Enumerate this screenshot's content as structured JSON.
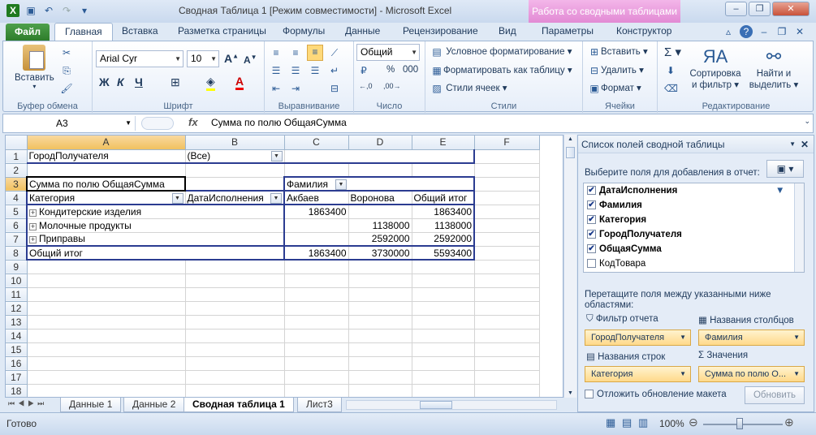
{
  "window": {
    "title": "Сводная Таблица 1  [Режим совместимости]  -  Microsoft Excel",
    "context_tab": "Работа со сводными таблицами"
  },
  "tabs": {
    "file": "Файл",
    "items": [
      "Главная",
      "Вставка",
      "Разметка страницы",
      "Формулы",
      "Данные",
      "Рецензирование",
      "Вид",
      "Параметры",
      "Конструктор"
    ]
  },
  "ribbon": {
    "clipboard": {
      "label": "Буфер обмена",
      "paste": "Вставить"
    },
    "font": {
      "label": "Шрифт",
      "name": "Arial Cyr",
      "size": "10"
    },
    "alignment": {
      "label": "Выравнивание"
    },
    "number": {
      "label": "Число",
      "format": "Общий",
      "percent": "%",
      "thousands": "000"
    },
    "styles": {
      "label": "Стили",
      "conditional": "Условное форматирование",
      "format_table": "Форматировать как таблицу",
      "cell_styles": "Стили ячеек"
    },
    "cells": {
      "label": "Ячейки",
      "insert": "Вставить",
      "delete": "Удалить",
      "format": "Формат"
    },
    "editing": {
      "label": "Редактирование",
      "sort_line1": "Сортировка",
      "sort_line2": "и фильтр",
      "find_line1": "Найти и",
      "find_line2": "выделить"
    }
  },
  "formula_bar": {
    "cell": "A3",
    "fx": "fx",
    "content": "Сумма по полю ОбщаяСумма"
  },
  "sheet": {
    "columns": [
      "A",
      "B",
      "C",
      "D",
      "E",
      "F"
    ],
    "rows": [
      "1",
      "2",
      "3",
      "4",
      "5",
      "6",
      "7",
      "8",
      "9",
      "10",
      "11",
      "12",
      "13",
      "14",
      "15",
      "16",
      "17",
      "18"
    ],
    "cells": {
      "a1": "ГородПолучателя",
      "b1": "(Все)",
      "a3": "Сумма по полю ОбщаяСумма",
      "c3": "Фамилия",
      "a4": "Категория",
      "b4": "ДатаИсполнения",
      "c4": "Акбаев",
      "d4": "Воронова",
      "e4": "Общий итог",
      "a5": "Кондитерские изделия",
      "c5": "1863400",
      "e5": "1863400",
      "a6": "Молочные продукты",
      "d6": "1138000",
      "e6": "1138000",
      "a7": "Приправы",
      "d7": "2592000",
      "e7": "2592000",
      "a8": "Общий итог",
      "c8": "1863400",
      "d8": "3730000",
      "e8": "5593400"
    }
  },
  "sheet_tabs": [
    "Данные 1",
    "Данные 2",
    "Сводная таблица 1",
    "Лист3"
  ],
  "status": {
    "ready": "Готово",
    "zoom": "100%"
  },
  "pivot_pane": {
    "title": "Список полей сводной таблицы",
    "choose_label": "Выберите поля для добавления в отчет:",
    "fields": [
      {
        "name": "ДатаИсполнения",
        "checked": true
      },
      {
        "name": "Фамилия",
        "checked": true
      },
      {
        "name": "Категория",
        "checked": true
      },
      {
        "name": "ГородПолучателя",
        "checked": true
      },
      {
        "name": "ОбщаяСумма",
        "checked": true
      },
      {
        "name": "КодТовара",
        "checked": false
      }
    ],
    "drag_label": "Перетащите поля между указанными ниже областями:",
    "report_filter": "Фильтр отчета",
    "column_labels": "Названия столбцов",
    "row_labels": "Названия строк",
    "values": "Значения",
    "filter_field": "ГородПолучателя",
    "column_field": "Фамилия",
    "row_field": "Категория",
    "value_field": "Сумма по полю О...",
    "defer": "Отложить обновление макета",
    "update": "Обновить"
  }
}
